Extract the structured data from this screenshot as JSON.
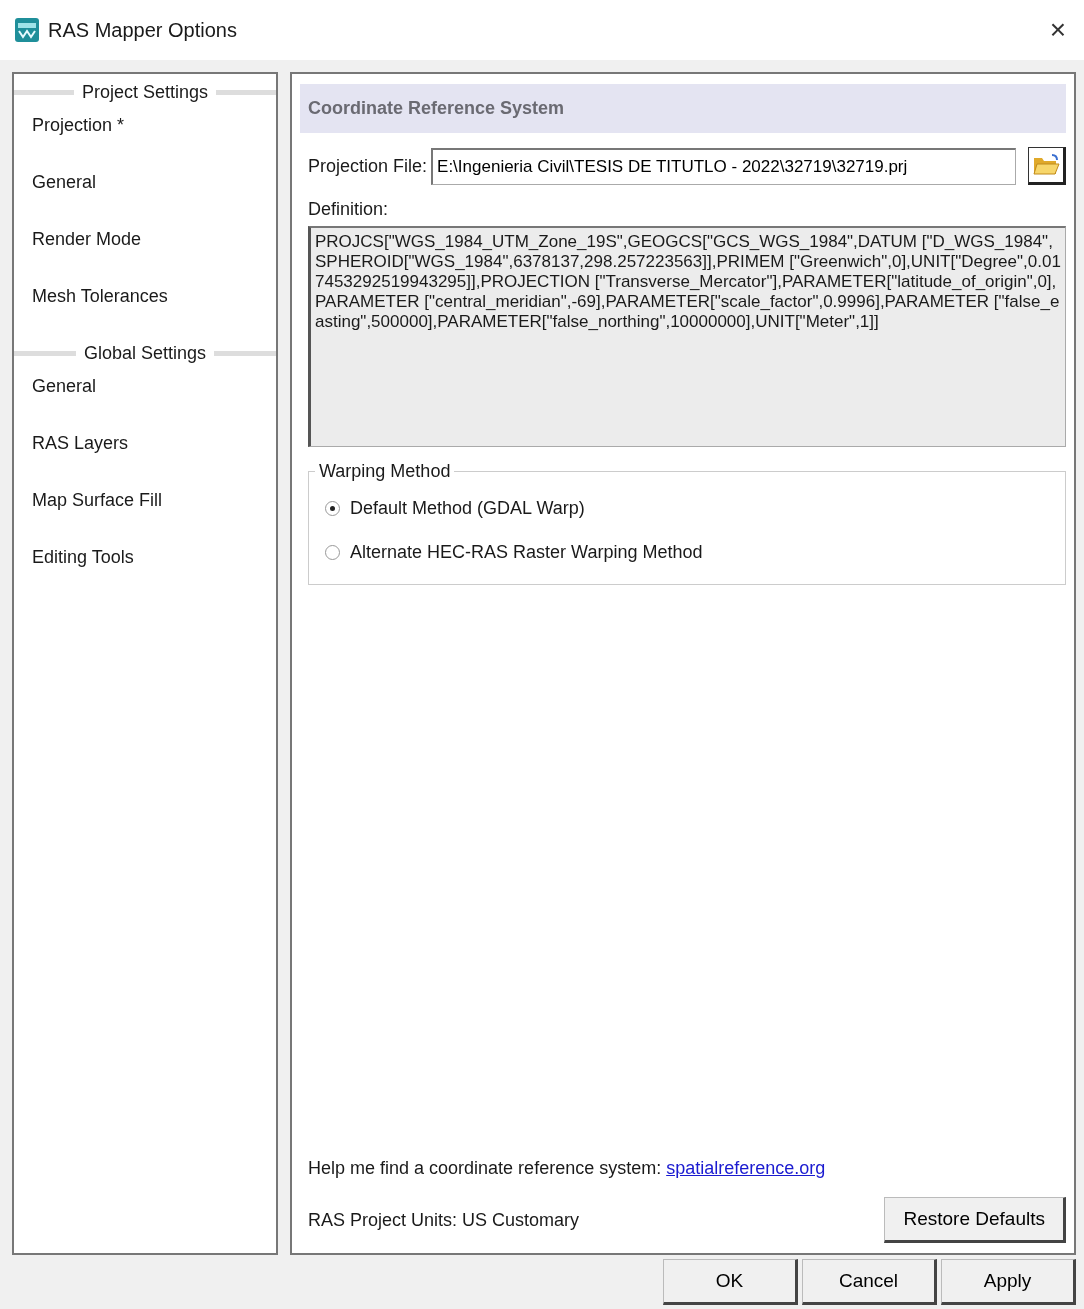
{
  "window": {
    "title": "RAS Mapper Options",
    "close": "×"
  },
  "sidebar": {
    "sections": [
      {
        "header": "Project Settings",
        "items": [
          {
            "label": "Projection *"
          },
          {
            "label": "General"
          },
          {
            "label": "Render Mode"
          },
          {
            "label": "Mesh Tolerances"
          }
        ]
      },
      {
        "header": "Global Settings",
        "items": [
          {
            "label": "General"
          },
          {
            "label": "RAS Layers"
          },
          {
            "label": "Map Surface Fill"
          },
          {
            "label": "Editing Tools"
          }
        ]
      }
    ]
  },
  "panel": {
    "header": "Coordinate Reference System",
    "projection_file": {
      "label": "Projection File:",
      "value": "E:\\Ingenieria Civil\\TESIS DE TITUTLO - 2022\\32719\\32719.prj"
    },
    "definition": {
      "label": "Definition:",
      "value": "PROJCS[\"WGS_1984_UTM_Zone_19S\",GEOGCS[\"GCS_WGS_1984\",DATUM [\"D_WGS_1984\",SPHEROID[\"WGS_1984\",6378137,298.257223563]],PRIMEM [\"Greenwich\",0],UNIT[\"Degree\",0.017453292519943295]],PROJECTION [\"Transverse_Mercator\"],PARAMETER[\"latitude_of_origin\",0],PARAMETER [\"central_meridian\",-69],PARAMETER[\"scale_factor\",0.9996],PARAMETER [\"false_easting\",500000],PARAMETER[\"false_northing\",10000000],UNIT[\"Meter\",1]]"
    },
    "warping": {
      "legend": "Warping Method",
      "options": [
        {
          "label": "Default Method (GDAL Warp)",
          "selected": true
        },
        {
          "label": "Alternate HEC-RAS Raster Warping Method",
          "selected": false
        }
      ]
    },
    "help": {
      "text": "Help me find a coordinate reference system:",
      "link": "spatialreference.org"
    },
    "units": "RAS Project Units: US Customary",
    "restore_button": "Restore Defaults"
  },
  "buttons": [
    "OK",
    "Cancel",
    "Apply"
  ]
}
